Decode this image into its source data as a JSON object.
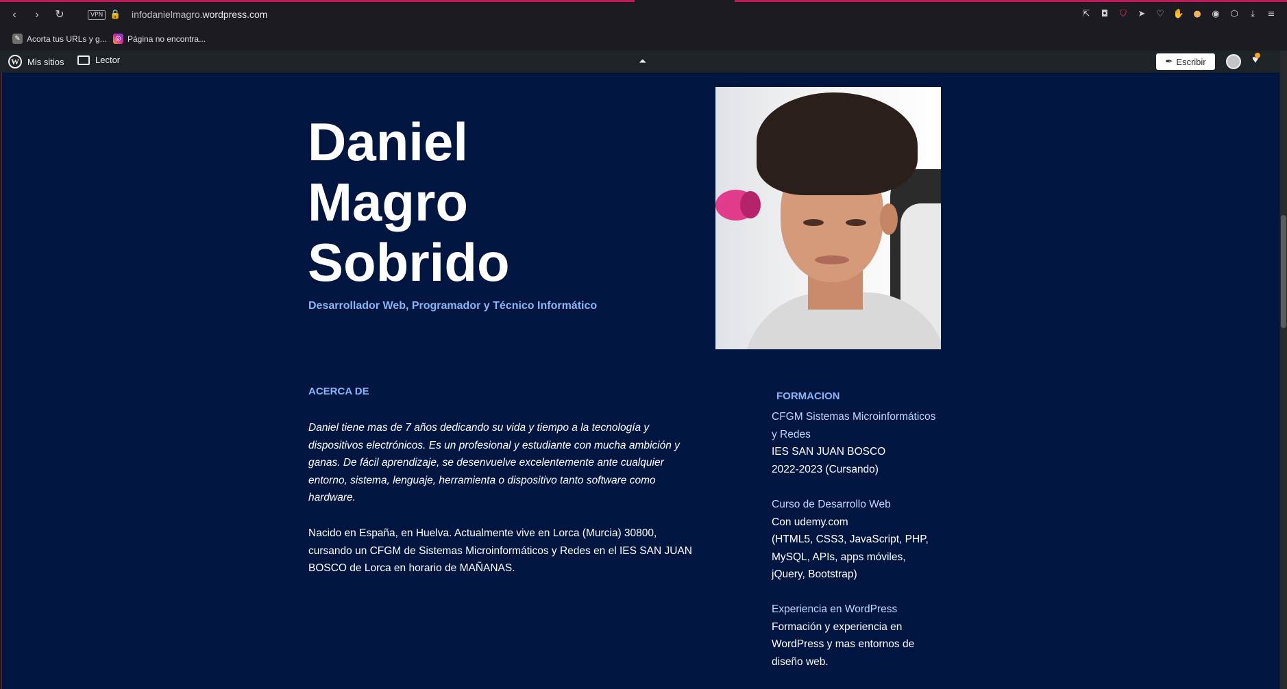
{
  "browser": {
    "url_prefix": "infodanielmagro.",
    "url_host": "wordpress.com",
    "vpn_label": "VPN",
    "bookmarks": [
      {
        "label": "Acorta tus URLs y g..."
      },
      {
        "label": "Página no encontra..."
      }
    ]
  },
  "wp_admin_bar": {
    "my_sites": "Mis sitios",
    "reader": "Lector",
    "write": "Escribir"
  },
  "hero": {
    "name_line1": "Daniel",
    "name_line2": "Magro",
    "name_line3": "Sobrido",
    "tagline": "Desarrollador Web, Programador y Técnico Informático"
  },
  "about": {
    "heading": "ACERCA DE",
    "paragraph1": "Daniel tiene mas de 7 años dedicando su vida y tiempo a la tecnología y dispositivos electrónicos. Es un profesional y estudiante con mucha ambición y ganas. De fácil aprendizaje, se desenvuelve excelentemente ante cualquier entorno, sistema, lenguaje, herramienta o dispositivo tanto software como hardware.",
    "paragraph2": "Nacido en España, en Huelva. Actualmente vive en Lorca (Murcia) 30800, cursando un CFGM de Sistemas Microinformáticos y Redes en el IES SAN JUAN BOSCO de Lorca en horario de MAÑANAS."
  },
  "formacion": {
    "heading": "FORMACION",
    "items": [
      {
        "title": "CFGM Sistemas Microinformáticos y Redes",
        "line1": "IES SAN JUAN BOSCO",
        "line2": "2022-2023 (Cursando)"
      },
      {
        "title": "Curso de Desarrollo Web",
        "line1": "Con udemy.com",
        "line2": "(HTML5, CSS3, JavaScript, PHP, MySQL, APIs, apps móviles, jQuery, Bootstrap)"
      },
      {
        "title": "Experiencia en WordPress",
        "line1": "Formación y experiencia en WordPress y mas entornos de diseño web.",
        "line2": ""
      }
    ]
  },
  "colors": {
    "page_bg": "#001641",
    "accent": "#8ab4f8",
    "admin_bar": "#1d2327"
  }
}
